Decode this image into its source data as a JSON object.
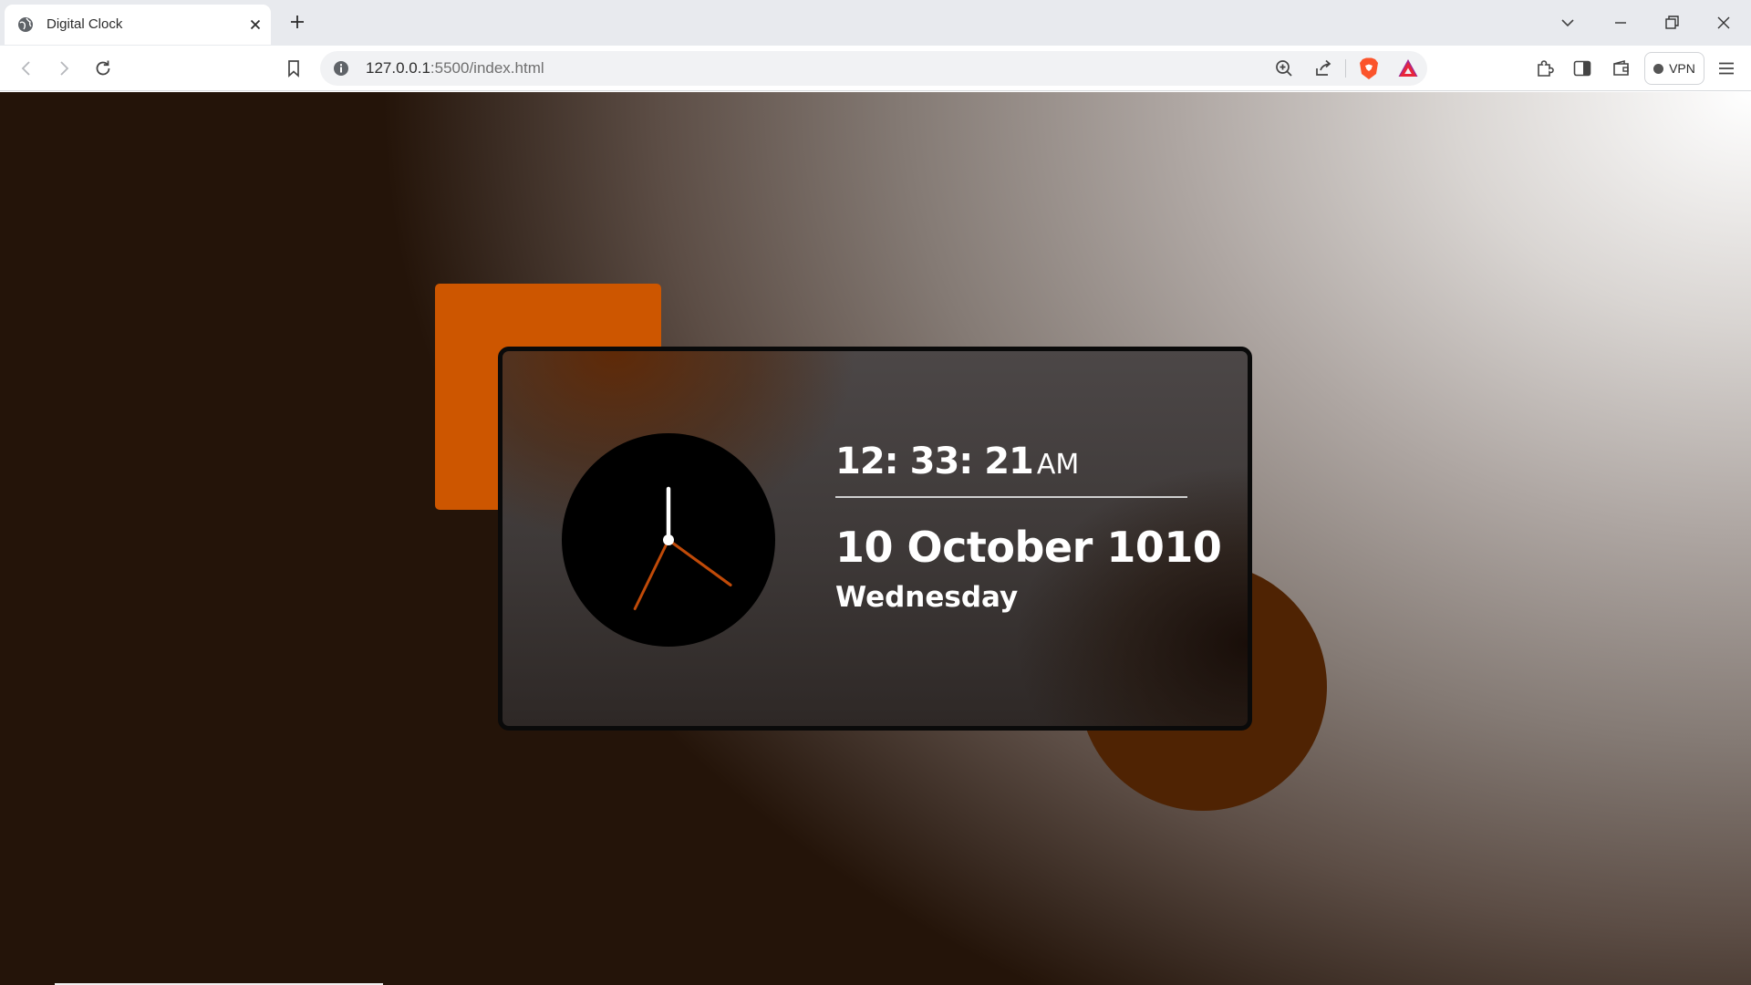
{
  "browser": {
    "tab_title": "Digital Clock",
    "url_host": "127.0.0.1",
    "url_path": ":5500/index.html",
    "vpn_label": "VPN"
  },
  "icons": {
    "tab_favicon": "globe-icon",
    "tab_close": "close-icon",
    "new_tab": "plus-icon",
    "tab_search": "chevron-down-icon",
    "minimize": "minimize-icon",
    "restore": "restore-icon",
    "close_window": "close-icon",
    "back": "back-arrow-icon",
    "forward": "forward-arrow-icon",
    "reload": "reload-icon",
    "bookmark": "bookmark-icon",
    "site_info": "info-icon",
    "zoom": "zoom-in-icon",
    "share": "share-icon",
    "brave_shields": "brave-lion-icon",
    "rewards": "rewards-triangle-icon",
    "extensions": "puzzle-icon",
    "sidebar": "sidebar-icon",
    "wallet": "wallet-icon",
    "menu": "hamburger-menu-icon"
  },
  "clock": {
    "hours": "12",
    "minutes": "33",
    "seconds": "21",
    "separator": ":",
    "ampm": "AM",
    "day_number": "10",
    "month": "October",
    "year": "1010",
    "weekday": "Wednesday",
    "analog_hour": 12,
    "analog_minute": 33,
    "analog_second": 21
  },
  "colors": {
    "accent_orange": "#cd5600",
    "accent_brown": "#4f2303",
    "hand_color": "#c04a08",
    "hour_hand_color": "#ffffff"
  }
}
